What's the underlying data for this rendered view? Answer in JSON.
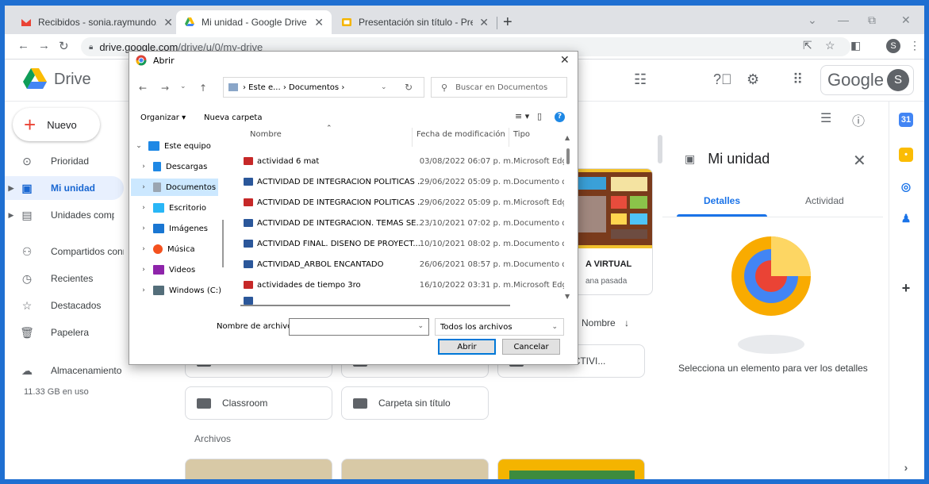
{
  "browser": {
    "tabs": [
      {
        "title": "Recibidos - sonia.raymundo.arr@",
        "icon": "gmail-icon",
        "active": false
      },
      {
        "title": "Mi unidad - Google Drive",
        "icon": "drive-icon",
        "active": true
      },
      {
        "title": "Presentación sin título - Presenta",
        "icon": "slides-icon",
        "active": false
      }
    ],
    "new_tab": "+",
    "url_host": "drive.google.com",
    "url_path": "/drive/u/0/my-drive",
    "profile_initial": "S"
  },
  "drive": {
    "title": "Drive",
    "brand": "Google",
    "avatar_initial": "S",
    "new_label": "Nuevo",
    "sidebar": [
      {
        "label": "Prioridad",
        "icon": "check-circle-icon"
      },
      {
        "label": "Mi unidad",
        "icon": "my-drive-icon"
      },
      {
        "label": "Unidades compartidas",
        "icon": "shared-drives-icon"
      },
      {
        "label": "Compartidos conmigo",
        "icon": "people-icon"
      },
      {
        "label": "Recientes",
        "icon": "clock-icon"
      },
      {
        "label": "Destacados",
        "icon": "star-icon"
      },
      {
        "label": "Papelera",
        "icon": "trash-icon"
      },
      {
        "label": "Almacenamiento",
        "icon": "cloud-icon"
      }
    ],
    "storage_text": "11.33 GB en uso",
    "suggested": {
      "title": "A VIRTUAL",
      "subtitle": "ana pasada"
    },
    "sort_label": "Nombre",
    "folders": [
      {
        "name": "AS DE ACTIVI..."
      },
      {
        "name": "Classroom"
      },
      {
        "name": "Carpeta sin título"
      }
    ],
    "files_section": "Archivos",
    "details": {
      "title": "Mi unidad",
      "tab_details": "Detalles",
      "tab_activity": "Actividad",
      "empty_message": "Selecciona un elemento para ver los detalles"
    }
  },
  "dialog": {
    "title": "Abrir",
    "path": "› Este e... › Documentos ›",
    "search_placeholder": "Buscar en Documentos",
    "organize": "Organizar ▾",
    "new_folder": "Nueva carpeta",
    "tree": [
      {
        "label": "Este equipo",
        "caret": "v",
        "icon_color": "#1e88e5"
      },
      {
        "label": "Descargas",
        "caret": ">",
        "icon_color": "#1e88e5"
      },
      {
        "label": "Documentos",
        "caret": ">",
        "icon_color": "#9aa5b1",
        "selected": true
      },
      {
        "label": "Escritorio",
        "caret": ">",
        "icon_color": "#29b6f6"
      },
      {
        "label": "Imágenes",
        "caret": ">",
        "icon_color": "#1976d2"
      },
      {
        "label": "Música",
        "caret": ">",
        "icon_color": "#f4511e"
      },
      {
        "label": "Videos",
        "caret": ">",
        "icon_color": "#8e24aa"
      },
      {
        "label": "Windows (C:)",
        "caret": ">",
        "icon_color": "#546e7a"
      }
    ],
    "columns": {
      "name": "Nombre",
      "modified": "Fecha de modificación",
      "type": "Tipo"
    },
    "files": [
      {
        "name": "actividad 6 mat",
        "modified": "03/08/2022 06:07 p. m.",
        "type": "Microsoft Edg",
        "kind": "pdf"
      },
      {
        "name": "ACTIVIDAD DE INTEGRACION POLITICAS ...",
        "modified": "29/06/2022 05:09 p. m.",
        "type": "Documento de",
        "kind": "doc"
      },
      {
        "name": "ACTIVIDAD DE INTEGRACION POLITICAS ...",
        "modified": "29/06/2022 05:09 p. m.",
        "type": "Microsoft Edg",
        "kind": "pdf"
      },
      {
        "name": "ACTIVIDAD DE INTEGRACIÓN. TEMAS SE...",
        "modified": "23/10/2021 07:02 p. m.",
        "type": "Documento de",
        "kind": "doc"
      },
      {
        "name": "ACTIVIDAD FINAL. DISEÑO DE PROYECT...",
        "modified": "10/10/2021 08:02 p. m.",
        "type": "Documento de",
        "kind": "doc"
      },
      {
        "name": "ACTIVIDAD_ARBOL ENCANTADO",
        "modified": "26/06/2021 08:57 p. m.",
        "type": "Documento de",
        "kind": "doc"
      },
      {
        "name": "actividades de tiempo 3ro",
        "modified": "16/10/2022 03:31 p. m.",
        "type": "Microsoft Edg",
        "kind": "pdf"
      }
    ],
    "filename_label": "Nombre de archivo:",
    "filename_value": "",
    "filetype": "Todos los archivos",
    "open_button": "Abrir",
    "cancel_button": "Cancelar"
  }
}
